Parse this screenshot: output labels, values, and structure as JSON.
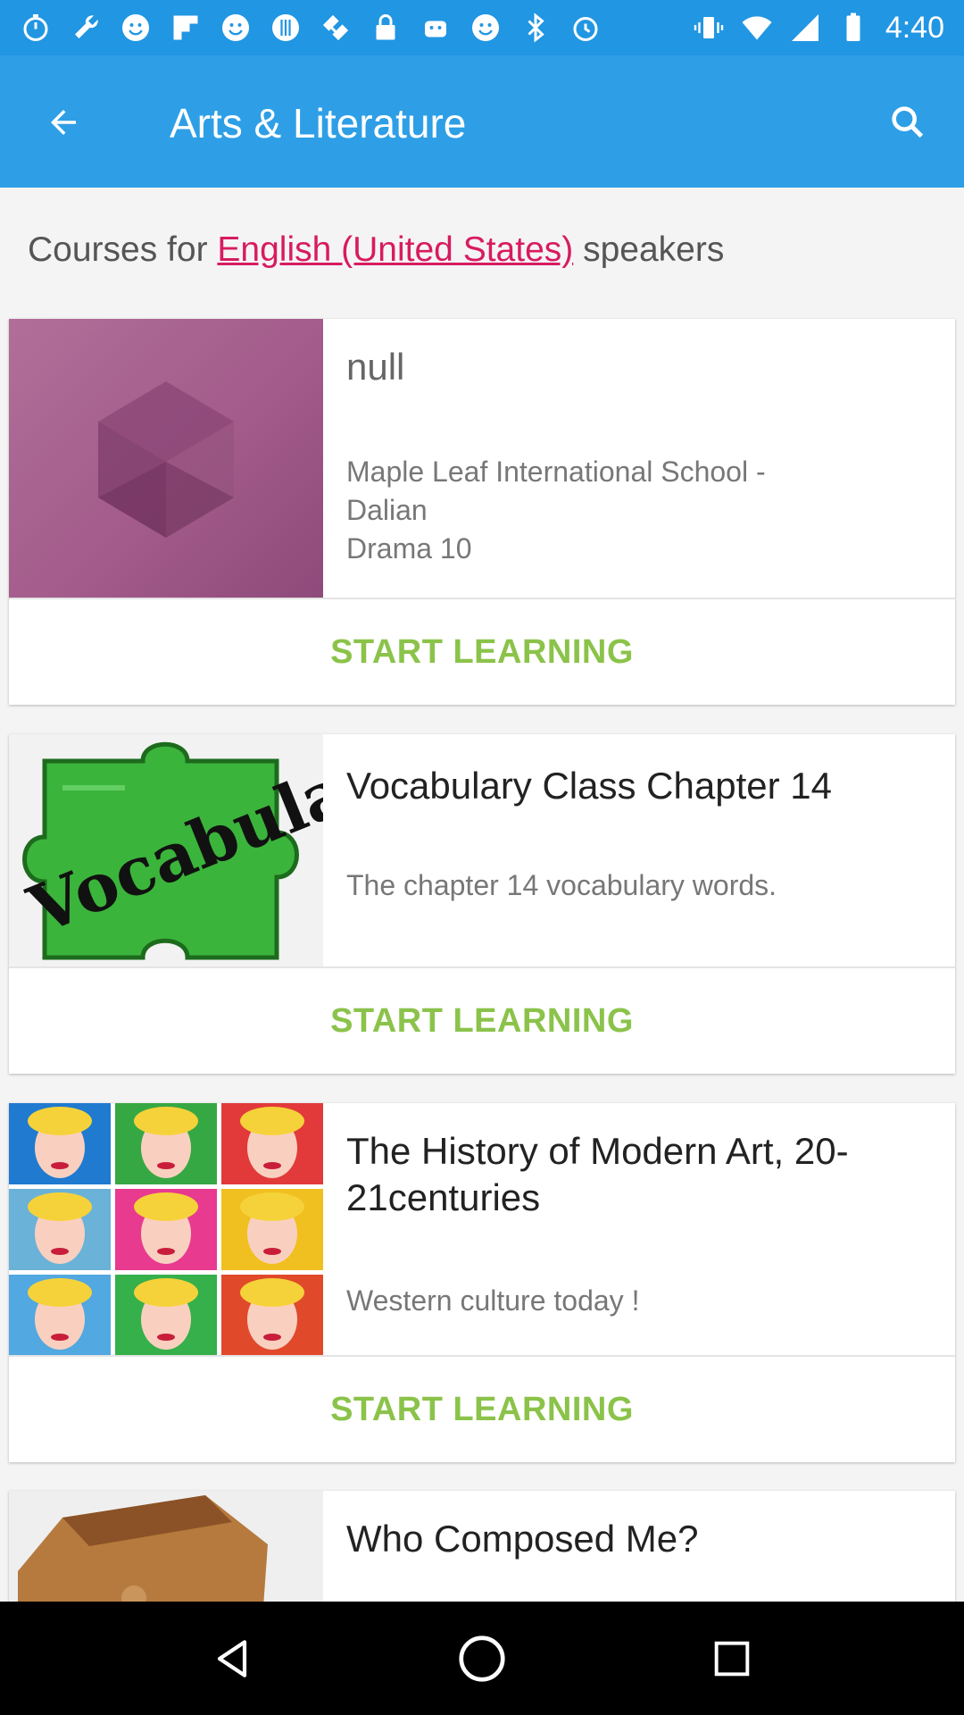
{
  "status_bar": {
    "time": "4:40",
    "icons": [
      "timer-icon",
      "wrench-icon",
      "smiley-icon",
      "flipboard-icon",
      "smiley-icon",
      "disc-icon",
      "satellite-icon",
      "lock-icon",
      "android-icon",
      "smiley-icon",
      "bluetooth-icon",
      "alarm-icon",
      "vibrate-icon",
      "wifi-icon",
      "signal-icon",
      "battery-icon"
    ]
  },
  "toolbar": {
    "title": "Arts & Literature",
    "back_icon": "arrow-back-icon",
    "search_icon": "search-icon"
  },
  "subheader": {
    "prefix": "Courses for ",
    "language": "English (United States)",
    "suffix": " speakers"
  },
  "courses": [
    {
      "title": "null",
      "description": "Maple Leaf International School -\nDalian\nDrama 10",
      "action": "START LEARNING",
      "thumb": "purple-cube-logo"
    },
    {
      "title": "Vocabulary Class Chapter 14",
      "description": "The chapter 14 vocabulary words.",
      "action": "START LEARNING",
      "thumb": "vocabulary-puzzle-image",
      "thumb_word": "Vocabulary"
    },
    {
      "title": "The History of Modern Art, 20-21centuries",
      "description": "Western culture today !",
      "action": "START LEARNING",
      "thumb": "pop-art-portrait-grid"
    },
    {
      "title": "Who Composed Me?",
      "thumb": "wooden-piano-image"
    }
  ],
  "colors": {
    "status_bar": "#2196e3",
    "toolbar": "#2e9fe6",
    "accent_link": "#d81b60",
    "action_green": "#8bc34a",
    "cube_purple": "#a35c8c"
  },
  "nav_bar": {
    "back": "nav-back-icon",
    "home": "nav-home-icon",
    "recents": "nav-recents-icon"
  }
}
